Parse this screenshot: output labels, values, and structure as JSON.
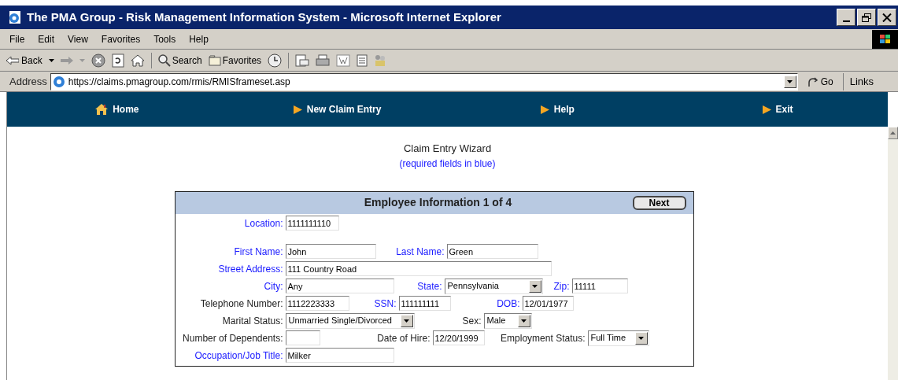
{
  "window": {
    "title": "The PMA Group - Risk Management Information System - Microsoft Internet Explorer"
  },
  "menu": [
    "File",
    "Edit",
    "View",
    "Favorites",
    "Tools",
    "Help"
  ],
  "toolbar": {
    "back": "Back",
    "search": "Search",
    "favorites": "Favorites"
  },
  "address": {
    "label": "Address",
    "url": "https://claims.pmagroup.com/rmis/RMISframeset.asp",
    "go": "Go",
    "links": "Links"
  },
  "nav": [
    {
      "label": "Home",
      "kind": "home"
    },
    {
      "label": "New Claim Entry",
      "kind": "arrow"
    },
    {
      "label": "Help",
      "kind": "arrow"
    },
    {
      "label": "Exit",
      "kind": "arrow"
    }
  ],
  "wizard": {
    "title": "Claim Entry Wizard",
    "note": "(required fields in blue)"
  },
  "form": {
    "title": "Employee Information 1 of 4",
    "next": "Next",
    "rows": [
      [
        {
          "label": "Location:",
          "value": "1111111110",
          "kind": "text",
          "required": true
        }
      ],
      [
        {
          "label": "First Name:",
          "value": "John",
          "kind": "text",
          "required": true
        },
        {
          "label": "Last Name:",
          "value": "Green",
          "kind": "text",
          "required": true
        }
      ],
      [
        {
          "label": "Street Address:",
          "value": "111 Country Road",
          "kind": "text",
          "required": true
        }
      ],
      [
        {
          "label": "City:",
          "value": "Any",
          "kind": "text",
          "required": true
        },
        {
          "label": "State:",
          "value": "Pennsylvania",
          "kind": "select",
          "required": true
        },
        {
          "label": "Zip:",
          "value": "11111",
          "kind": "text",
          "required": true
        }
      ],
      [
        {
          "label": "Telephone Number:",
          "value": "1112223333",
          "kind": "text",
          "required": false
        },
        {
          "label": "SSN:",
          "value": "111111111",
          "kind": "text",
          "required": true
        },
        {
          "label": "DOB:",
          "value": "12/01/1977",
          "kind": "text",
          "required": true
        }
      ],
      [
        {
          "label": "Marital Status:",
          "value": "Unmarried Single/Divorced",
          "kind": "select",
          "required": false
        },
        {
          "label": "Sex:",
          "value": "Male",
          "kind": "select",
          "required": false
        }
      ],
      [
        {
          "label": "Number of Dependents:",
          "kind": "text",
          "required": false
        },
        {
          "label": "Date of Hire:",
          "value": "12/20/1999",
          "kind": "text",
          "required": false
        },
        {
          "label": "Employment Status:",
          "value": "Full Time",
          "kind": "select",
          "required": false
        }
      ],
      [
        {
          "label": "Occupation/Job Title:",
          "value": "Milker",
          "kind": "text",
          "required": true
        }
      ]
    ]
  }
}
